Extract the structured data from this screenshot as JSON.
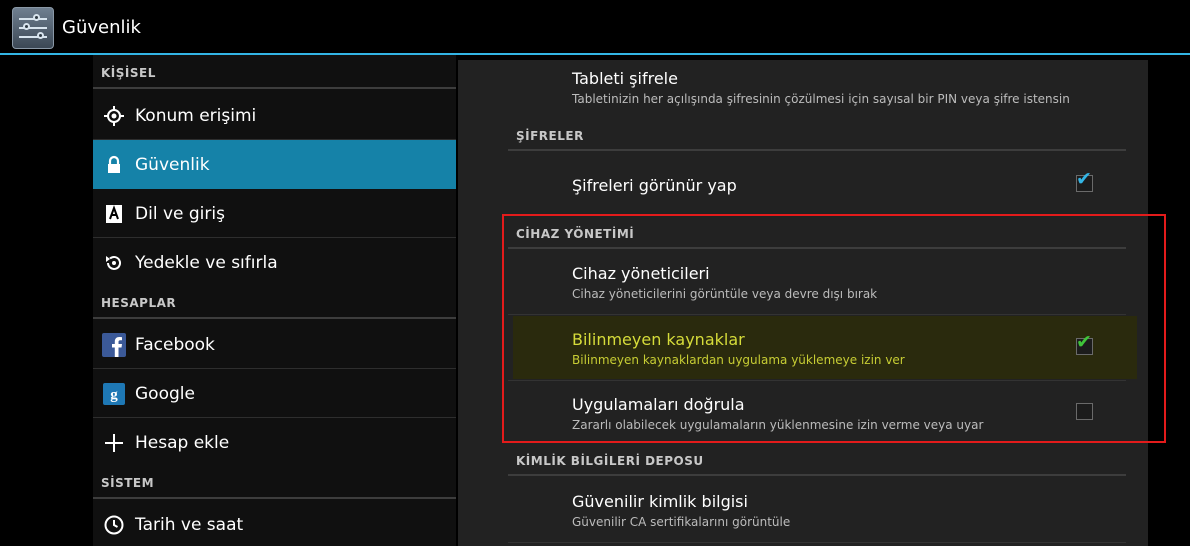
{
  "action_bar": {
    "title": "Güvenlik",
    "icon": "settings-sliders-icon",
    "accent": "#33b5e5"
  },
  "sidebar": {
    "sections": [
      {
        "header": "KİŞİSEL",
        "items": [
          {
            "label": "Konum erişimi",
            "icon": "location-icon"
          },
          {
            "label": "Güvenlik",
            "icon": "lock-icon",
            "selected": true
          },
          {
            "label": "Dil ve giriş",
            "icon": "keyboard-a-icon"
          },
          {
            "label": "Yedekle ve sıfırla",
            "icon": "backup-restore-icon"
          }
        ]
      },
      {
        "header": "HESAPLAR",
        "items": [
          {
            "label": "Facebook",
            "icon": "facebook-icon"
          },
          {
            "label": "Google",
            "icon": "google-icon"
          },
          {
            "label": "Hesap ekle",
            "icon": "plus-icon"
          }
        ]
      },
      {
        "header": "SİSTEM",
        "items": [
          {
            "label": "Tarih ve saat",
            "icon": "clock-icon"
          }
        ]
      }
    ],
    "selected_color": "#1582a8"
  },
  "main": {
    "encrypt": {
      "title": "Tableti şifrele",
      "subtitle": "Tabletinizin her açılışında şifresinin çözülmesi için sayısal bir PIN veya şifre istensin"
    },
    "passwords": {
      "header": "ŞİFRELER",
      "show_passwords": {
        "title": "Şifreleri görünür yap",
        "checked": true
      }
    },
    "device_admin": {
      "header": "CİHAZ YÖNETİMİ",
      "admins": {
        "title": "Cihaz yöneticileri",
        "subtitle": "Cihaz yöneticilerini görüntüle veya devre dışı bırak"
      },
      "unknown_sources": {
        "title": "Bilinmeyen kaynaklar",
        "subtitle": "Bilinmeyen kaynaklardan uygulama yüklemeye izin ver",
        "checked": true,
        "highlight_color": "#d6dc3a"
      },
      "verify_apps": {
        "title": "Uygulamaları doğrula",
        "subtitle": "Zararlı olabilecek uygulamaların yüklenmesine izin verme veya uyar",
        "checked": false
      },
      "annotation_frame_color": "#e31b1b"
    },
    "credential_storage": {
      "header": "KİMLİK BİLGİLERİ DEPOSU",
      "trusted": {
        "title": "Güvenilir kimlik bilgisi",
        "subtitle": "Güvenilir CA sertifikalarını görüntüle"
      }
    },
    "checkmark_glyph": "✔"
  }
}
